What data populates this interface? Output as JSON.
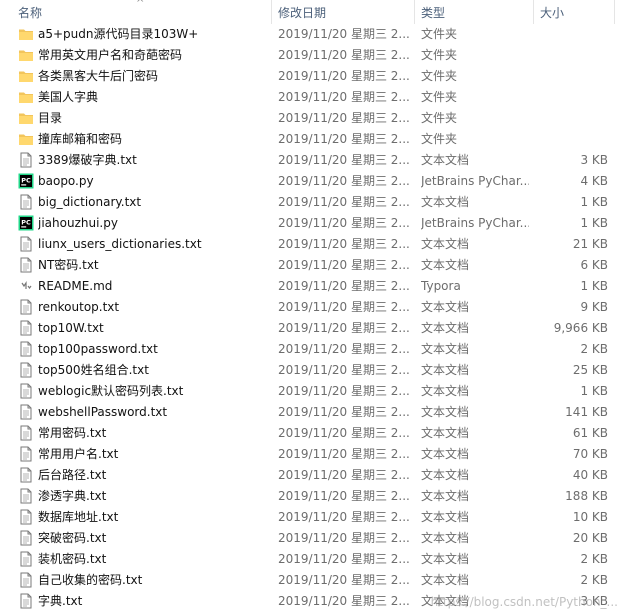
{
  "columns": {
    "name": "名称",
    "date": "修改日期",
    "type": "类型",
    "size": "大小"
  },
  "files": [
    {
      "name": "a5+pudn源代码目录103W+",
      "date": "2019/11/20 星期三 2...",
      "type": "文件夹",
      "size": "",
      "icon": "folder"
    },
    {
      "name": "常用英文用户名和奇葩密码",
      "date": "2019/11/20 星期三 2...",
      "type": "文件夹",
      "size": "",
      "icon": "folder"
    },
    {
      "name": "各类黑客大牛后门密码",
      "date": "2019/11/20 星期三 2...",
      "type": "文件夹",
      "size": "",
      "icon": "folder"
    },
    {
      "name": "美国人字典",
      "date": "2019/11/20 星期三 2...",
      "type": "文件夹",
      "size": "",
      "icon": "folder"
    },
    {
      "name": "目录",
      "date": "2019/11/20 星期三 2...",
      "type": "文件夹",
      "size": "",
      "icon": "folder"
    },
    {
      "name": "撞库邮箱和密码",
      "date": "2019/11/20 星期三 2...",
      "type": "文件夹",
      "size": "",
      "icon": "folder"
    },
    {
      "name": "3389爆破字典.txt",
      "date": "2019/11/20 星期三 2...",
      "type": "文本文档",
      "size": "3 KB",
      "icon": "txt"
    },
    {
      "name": "baopo.py",
      "date": "2019/11/20 星期三 2...",
      "type": "JetBrains PyChar...",
      "size": "4 KB",
      "icon": "pycharm"
    },
    {
      "name": "big_dictionary.txt",
      "date": "2019/11/20 星期三 2...",
      "type": "文本文档",
      "size": "1 KB",
      "icon": "txt"
    },
    {
      "name": "jiahouzhui.py",
      "date": "2019/11/20 星期三 2...",
      "type": "JetBrains PyChar...",
      "size": "1 KB",
      "icon": "pycharm"
    },
    {
      "name": "liunx_users_dictionaries.txt",
      "date": "2019/11/20 星期三 2...",
      "type": "文本文档",
      "size": "21 KB",
      "icon": "txt"
    },
    {
      "name": "NT密码.txt",
      "date": "2019/11/20 星期三 2...",
      "type": "文本文档",
      "size": "6 KB",
      "icon": "txt"
    },
    {
      "name": "README.md",
      "date": "2019/11/20 星期三 2...",
      "type": "Typora",
      "size": "1 KB",
      "icon": "md"
    },
    {
      "name": "renkoutop.txt",
      "date": "2019/11/20 星期三 2...",
      "type": "文本文档",
      "size": "9 KB",
      "icon": "txt"
    },
    {
      "name": "top10W.txt",
      "date": "2019/11/20 星期三 2...",
      "type": "文本文档",
      "size": "9,966 KB",
      "icon": "txt"
    },
    {
      "name": "top100password.txt",
      "date": "2019/11/20 星期三 2...",
      "type": "文本文档",
      "size": "2 KB",
      "icon": "txt"
    },
    {
      "name": "top500姓名组合.txt",
      "date": "2019/11/20 星期三 2...",
      "type": "文本文档",
      "size": "25 KB",
      "icon": "txt"
    },
    {
      "name": "weblogic默认密码列表.txt",
      "date": "2019/11/20 星期三 2...",
      "type": "文本文档",
      "size": "1 KB",
      "icon": "txt"
    },
    {
      "name": "webshellPassword.txt",
      "date": "2019/11/20 星期三 2...",
      "type": "文本文档",
      "size": "141 KB",
      "icon": "txt"
    },
    {
      "name": "常用密码.txt",
      "date": "2019/11/20 星期三 2...",
      "type": "文本文档",
      "size": "61 KB",
      "icon": "txt"
    },
    {
      "name": "常用用户名.txt",
      "date": "2019/11/20 星期三 2...",
      "type": "文本文档",
      "size": "70 KB",
      "icon": "txt"
    },
    {
      "name": "后台路径.txt",
      "date": "2019/11/20 星期三 2...",
      "type": "文本文档",
      "size": "40 KB",
      "icon": "txt"
    },
    {
      "name": "渗透字典.txt",
      "date": "2019/11/20 星期三 2...",
      "type": "文本文档",
      "size": "188 KB",
      "icon": "txt"
    },
    {
      "name": "数据库地址.txt",
      "date": "2019/11/20 星期三 2...",
      "type": "文本文档",
      "size": "10 KB",
      "icon": "txt"
    },
    {
      "name": "突破密码.txt",
      "date": "2019/11/20 星期三 2...",
      "type": "文本文档",
      "size": "20 KB",
      "icon": "txt"
    },
    {
      "name": "装机密码.txt",
      "date": "2019/11/20 星期三 2...",
      "type": "文本文档",
      "size": "2 KB",
      "icon": "txt"
    },
    {
      "name": "自己收集的密码.txt",
      "date": "2019/11/20 星期三 2...",
      "type": "文本文档",
      "size": "2 KB",
      "icon": "txt"
    },
    {
      "name": "字典.txt",
      "date": "2019/11/20 星期三 2...",
      "type": "文本文档",
      "size": "3 KB",
      "icon": "txt"
    }
  ],
  "watermark": "https://blog.csdn.net/Python_..."
}
